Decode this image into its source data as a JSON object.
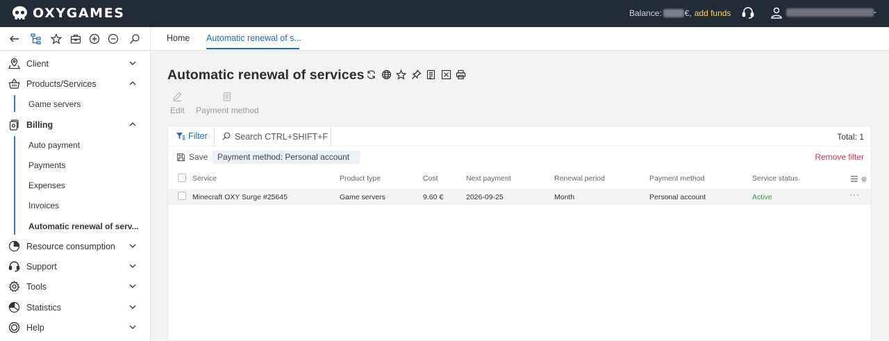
{
  "app": {
    "brand": "OXYGAMES",
    "balance_label": "Balance:",
    "balance_currency": "€,",
    "add_funds": "add funds"
  },
  "tabs": [
    {
      "label": "Home"
    },
    {
      "label": "Automatic renewal of s..."
    }
  ],
  "sidebar": {
    "items": [
      {
        "label": "Client",
        "icon": "map-pin-icon",
        "expanded": false
      },
      {
        "label": "Products/Services",
        "icon": "basket-icon",
        "expanded": true
      },
      {
        "label": "Billing",
        "icon": "billing-icon",
        "expanded": true
      },
      {
        "label": "Resource consumption",
        "icon": "pie-chart-icon",
        "expanded": false
      },
      {
        "label": "Support",
        "icon": "headset-icon",
        "expanded": false
      },
      {
        "label": "Tools",
        "icon": "gear-icon",
        "expanded": false
      },
      {
        "label": "Statistics",
        "icon": "chart-icon",
        "expanded": false
      },
      {
        "label": "Help",
        "icon": "lifebuoy-icon",
        "expanded": false
      }
    ],
    "products_sub": [
      "Game servers"
    ],
    "billing_sub": [
      "Auto payment",
      "Payments",
      "Expenses",
      "Invoices",
      "Automatic renewal of serv..."
    ]
  },
  "page": {
    "title": "Automatic renewal of services",
    "actions": [
      {
        "label": "Edit"
      },
      {
        "label": "Payment method"
      }
    ]
  },
  "filterbar": {
    "filter_label": "Filter",
    "search_placeholder": "Search CTRL+SHIFT+F",
    "total": "Total: 1",
    "save_label": "Save",
    "active_filter": "Payment method: Personal account",
    "remove_filter": "Remove filter"
  },
  "table": {
    "columns": [
      "Service",
      "Product type",
      "Cost",
      "Next payment",
      "Renewal period",
      "Payment method",
      "Service status"
    ],
    "rows": [
      [
        "Minecraft OXY Surge #25645",
        "Game servers",
        "9.60 €",
        "2026-09-25",
        "Month",
        "Personal account",
        "Active"
      ]
    ]
  },
  "colors": {
    "topbar": "#222b38",
    "accent": "#1e6fb8",
    "add_funds": "#ffd43b",
    "remove": "#d6334b",
    "status_active": "#2e9e3e"
  }
}
